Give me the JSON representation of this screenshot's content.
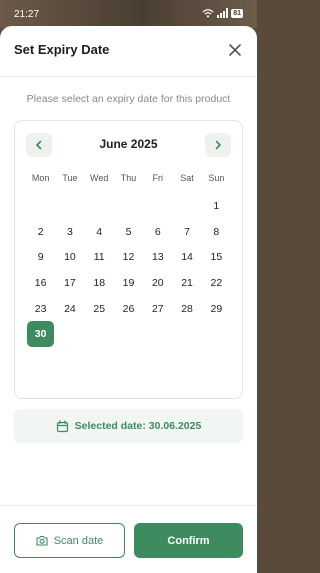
{
  "status_bar": {
    "time": "21:27",
    "battery": "81"
  },
  "sheet": {
    "title": "Set Expiry Date",
    "subtitle": "Please select an expiry date for this product"
  },
  "calendar": {
    "month_label": "June 2025",
    "weekdays": [
      "Mon",
      "Tue",
      "Wed",
      "Thu",
      "Fri",
      "Sat",
      "Sun"
    ],
    "days": [
      "",
      "",
      "",
      "",
      "",
      "",
      "1",
      "2",
      "3",
      "4",
      "5",
      "6",
      "7",
      "8",
      "9",
      "10",
      "11",
      "12",
      "13",
      "14",
      "15",
      "16",
      "17",
      "18",
      "19",
      "20",
      "21",
      "22",
      "23",
      "24",
      "25",
      "26",
      "27",
      "28",
      "29",
      "30"
    ],
    "selected_day": "30"
  },
  "selected": {
    "text": "Selected date: 30.06.2025"
  },
  "actions": {
    "scan_label": "Scan date",
    "confirm_label": "Confirm"
  },
  "colors": {
    "accent": "#3e8b5f",
    "accent_light": "#f1f6f3",
    "nav_button_bg": "#eef2ef"
  },
  "icons": {
    "close": "close-icon",
    "prev": "chevron-left-icon",
    "next": "chevron-right-icon",
    "calendar": "calendar-icon",
    "camera": "camera-icon",
    "wifi": "wifi-icon",
    "signal": "signal-icon",
    "battery": "battery-icon"
  }
}
